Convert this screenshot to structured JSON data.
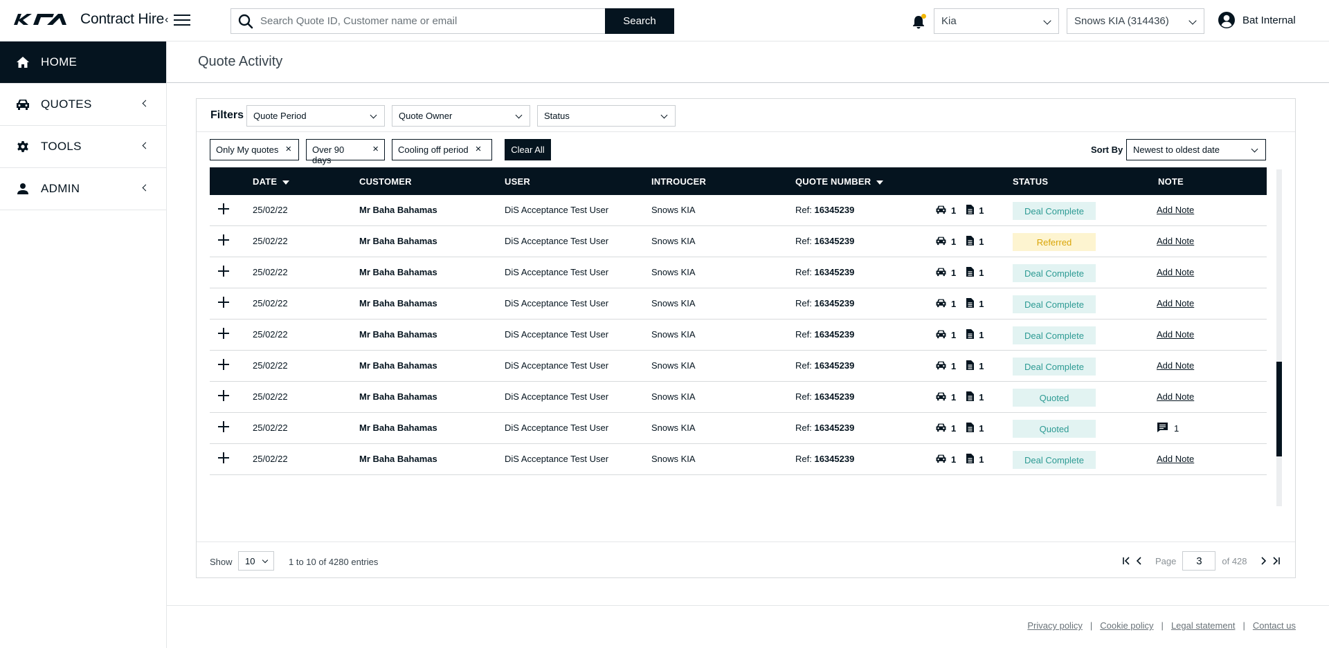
{
  "app": {
    "title": "Contract Hire",
    "search_placeholder": "Search Quote ID, Customer name or email",
    "search_button": "Search",
    "brand_select": "Kia",
    "dealer_select": "Snows KIA (314436)",
    "user_name": "Bat Internal"
  },
  "sidebar": {
    "items": [
      {
        "label": "HOME",
        "icon": "home-icon",
        "active": true
      },
      {
        "label": "QUOTES",
        "icon": "car-icon"
      },
      {
        "label": "TOOLS",
        "icon": "gear-icon"
      },
      {
        "label": "ADMIN",
        "icon": "person-icon"
      }
    ]
  },
  "page": {
    "title": "Quote Activity"
  },
  "filters": {
    "label": "Filters",
    "selects": [
      "Quote Period",
      "Quote Owner",
      "Status"
    ],
    "chips": [
      "Only My quotes",
      "Over 90 days",
      "Cooling off period"
    ],
    "clear_all": "Clear All",
    "sort_label": "Sort By",
    "sort_value": "Newest to oldest date"
  },
  "table": {
    "columns": {
      "date": "DATE",
      "customer": "CUSTOMER",
      "user": "USER",
      "introducer": "INTROUCER",
      "quote_number": "QUOTE NUMBER",
      "status": "STATUS",
      "note": "NOTE"
    },
    "ref_prefix": "Ref:",
    "rows": [
      {
        "date": "25/02/22",
        "customer": "Mr Baha Bahamas",
        "user": "DiS Acceptance Test User",
        "introducer": "Snows KIA",
        "quote": "16345239",
        "cars": "1",
        "docs": "1",
        "status": "Deal Complete",
        "note": "Add Note"
      },
      {
        "date": "25/02/22",
        "customer": "Mr Baha Bahamas",
        "user": "DiS Acceptance Test User",
        "introducer": "Snows KIA",
        "quote": "16345239",
        "cars": "1",
        "docs": "1",
        "status": "Referred",
        "note": "Add Note"
      },
      {
        "date": "25/02/22",
        "customer": "Mr Baha Bahamas",
        "user": "DiS Acceptance Test User",
        "introducer": "Snows KIA",
        "quote": "16345239",
        "cars": "1",
        "docs": "1",
        "status": "Deal Complete",
        "note": "Add Note"
      },
      {
        "date": "25/02/22",
        "customer": "Mr Baha Bahamas",
        "user": "DiS Acceptance Test User",
        "introducer": "Snows KIA",
        "quote": "16345239",
        "cars": "1",
        "docs": "1",
        "status": "Deal Complete",
        "note": "Add Note"
      },
      {
        "date": "25/02/22",
        "customer": "Mr Baha Bahamas",
        "user": "DiS Acceptance Test User",
        "introducer": "Snows KIA",
        "quote": "16345239",
        "cars": "1",
        "docs": "1",
        "status": "Deal Complete",
        "note": "Add Note"
      },
      {
        "date": "25/02/22",
        "customer": "Mr Baha Bahamas",
        "user": "DiS Acceptance Test User",
        "introducer": "Snows KIA",
        "quote": "16345239",
        "cars": "1",
        "docs": "1",
        "status": "Deal Complete",
        "note": "Add Note"
      },
      {
        "date": "25/02/22",
        "customer": "Mr Baha Bahamas",
        "user": "DiS Acceptance Test User",
        "introducer": "Snows KIA",
        "quote": "16345239",
        "cars": "1",
        "docs": "1",
        "status": "Quoted",
        "note": "Add Note"
      },
      {
        "date": "25/02/22",
        "customer": "Mr Baha Bahamas",
        "user": "DiS Acceptance Test User",
        "introducer": "Snows KIA",
        "quote": "16345239",
        "cars": "1",
        "docs": "1",
        "status": "Quoted",
        "note_count": "1"
      },
      {
        "date": "25/02/22",
        "customer": "Mr Baha Bahamas",
        "user": "DiS Acceptance Test User",
        "introducer": "Snows KIA",
        "quote": "16345239",
        "cars": "1",
        "docs": "1",
        "status": "Deal Complete",
        "note": "Add Note"
      }
    ]
  },
  "pagination": {
    "show_label": "Show",
    "page_size": "10",
    "entries": "1 to 10 of 4280 entries",
    "page_label": "Page",
    "current_page": "3",
    "of_label": "of 428"
  },
  "footer": {
    "links": [
      "Privacy policy",
      "Cookie policy",
      "Legal statement",
      "Contact us"
    ]
  },
  "colors": {
    "primary": "#05141f",
    "status_complete_bg": "#e2f3f2",
    "status_complete_text": "#2c9a93",
    "status_referred_bg": "#fdf4d0",
    "status_referred_text": "#d9a507",
    "notification_dot": "#f2b705"
  }
}
